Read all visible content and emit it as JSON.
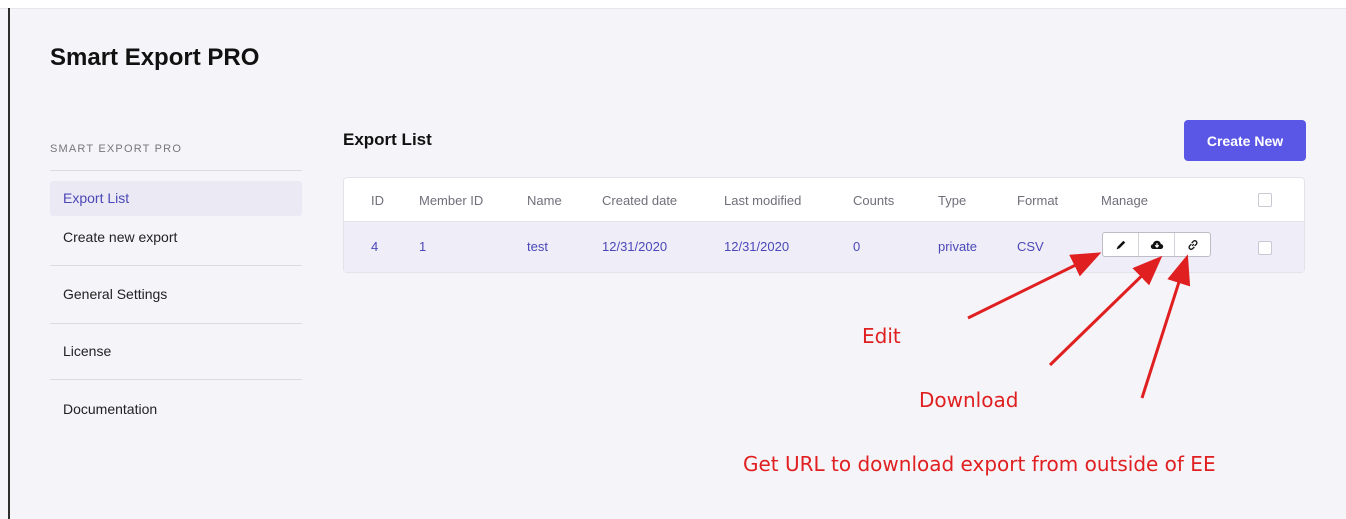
{
  "app": {
    "title": "Smart Export PRO"
  },
  "sidebar": {
    "heading": "SMART EXPORT PRO",
    "items": [
      {
        "label": "Export List",
        "active": true
      },
      {
        "label": "Create new export",
        "active": false
      },
      {
        "label": "General Settings",
        "active": false
      },
      {
        "label": "License",
        "active": false
      },
      {
        "label": "Documentation",
        "active": false
      }
    ]
  },
  "main": {
    "title": "Export List",
    "create_button": "Create New",
    "table": {
      "columns": [
        "ID",
        "Member ID",
        "Name",
        "Created date",
        "Last modified",
        "Counts",
        "Type",
        "Format",
        "Manage"
      ],
      "rows": [
        {
          "id": "4",
          "member_id": "1",
          "name": "test",
          "created": "12/31/2020",
          "modified": "12/31/2020",
          "counts": "0",
          "type": "private",
          "format": "CSV",
          "actions": [
            {
              "icon": "pencil-icon",
              "action": "edit"
            },
            {
              "icon": "cloud-download-icon",
              "action": "download"
            },
            {
              "icon": "link-icon",
              "action": "get-url"
            }
          ]
        }
      ]
    }
  },
  "annotations": {
    "edit": "Edit",
    "download": "Download",
    "url": "Get URL to download export from outside of EE"
  },
  "colors": {
    "accent": "#5b57e6",
    "link_text": "#4b48b8",
    "annotation": "#e02020",
    "background": "#f5f4f9"
  }
}
